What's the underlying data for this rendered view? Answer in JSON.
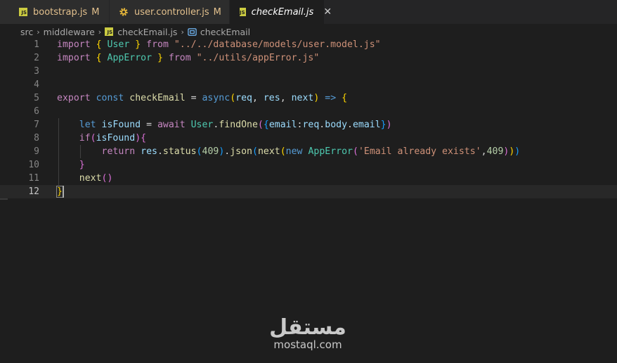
{
  "tabs": [
    {
      "label": "bootstrap.js",
      "modified": "M",
      "icon": "js-file-icon"
    },
    {
      "label": "user.controller.js",
      "modified": "M",
      "icon": "gear-icon"
    },
    {
      "label": "checkEmail.js",
      "icon": "js-file-icon",
      "active": true,
      "close": "✕"
    }
  ],
  "breadcrumb": {
    "segments": [
      "src",
      "middleware",
      "checkEmail.js",
      "checkEmail"
    ],
    "separator": "›"
  },
  "editor": {
    "line_numbers": [
      "1",
      "2",
      "3",
      "4",
      "5",
      "6",
      "7",
      "8",
      "9",
      "10",
      "11",
      "12"
    ],
    "current_line": "12",
    "code_lines": [
      "import { User } from \"../../database/models/user.model.js\"",
      "import { AppError } from \"../utils/appError.js\"",
      "",
      "",
      "export const checkEmail = async(req, res, next) => {",
      "",
      "    let isFound = await User.findOne({email:req.body.email})",
      "    if(isFound){",
      "        return res.status(409).json(next(new AppError('Email already exists',409)))",
      "    }",
      "    next()",
      "}"
    ]
  },
  "watermark": {
    "logo": "مستقل",
    "url": "mostaql.com"
  },
  "colors": {
    "background": "#1e1e1e",
    "keyword": "#c586c0",
    "storage": "#569cd6",
    "variable": "#9cdcfe",
    "function": "#dcdcaa",
    "class": "#4ec9b0",
    "string": "#ce9178",
    "number": "#b5cea8",
    "modified": "#e2c08d"
  }
}
